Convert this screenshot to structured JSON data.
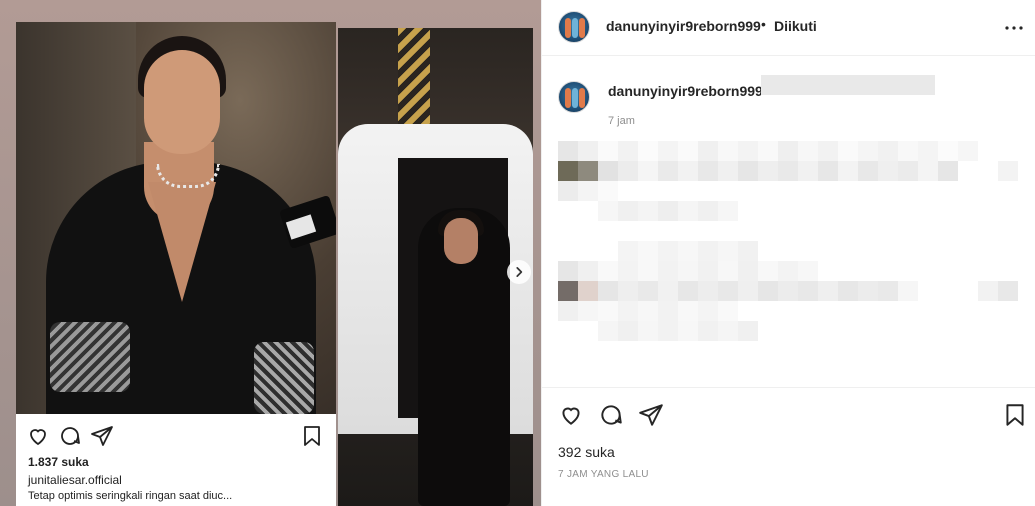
{
  "media": {
    "embedded_post": {
      "likes": "1.837 suka",
      "username": "junitaliesar.official",
      "caption": "Tetap optimis seringkali ringan saat diuc..."
    },
    "next_icon": "chevron-right-icon"
  },
  "header": {
    "username": "danunyinyir9reborn999",
    "separator": "•",
    "follow_status": "Diikuti",
    "more_icon": "more-horizontal-icon"
  },
  "comment": {
    "username": "danunyinyir9reborn999",
    "time": "7 jam"
  },
  "footer": {
    "likes": "392 suka",
    "timestamp": "7 JAM YANG LALU",
    "icons": [
      "heart-icon",
      "comment-icon",
      "share-icon",
      "bookmark-icon"
    ]
  },
  "colors": {
    "text": "#262626",
    "muted": "#8e8e8e",
    "divider": "#efefef"
  }
}
